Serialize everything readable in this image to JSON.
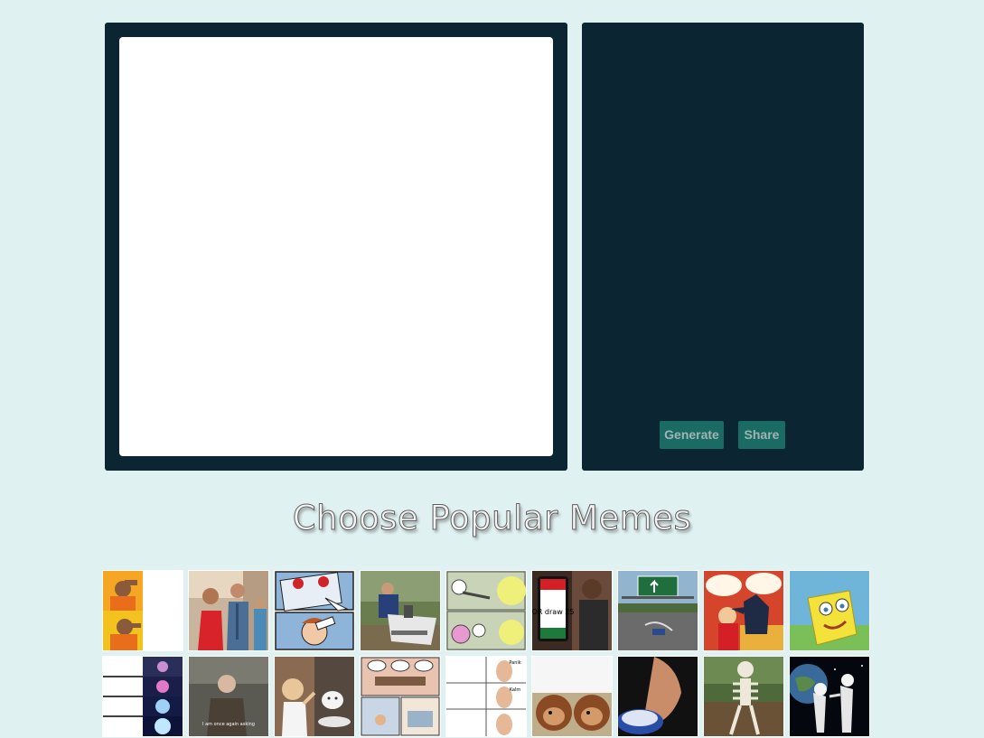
{
  "editor": {
    "generate_label": "Generate",
    "share_label": "Share"
  },
  "gallery": {
    "title": "Choose Popular Memes",
    "memes": [
      {
        "icon": "drake-meme-icon"
      },
      {
        "icon": "distracted-boyfriend-meme-icon"
      },
      {
        "icon": "two-buttons-meme-icon"
      },
      {
        "icon": "change-my-mind-meme-icon"
      },
      {
        "icon": "running-away-balloon-meme-icon"
      },
      {
        "icon": "uno-draw-25-meme-icon",
        "caption": "OR draw 25"
      },
      {
        "icon": "left-exit-12-off-ramp-meme-icon"
      },
      {
        "icon": "batman-slapping-robin-meme-icon"
      },
      {
        "icon": "mocking-spongebob-meme-icon"
      },
      {
        "icon": "expanding-brain-meme-icon"
      },
      {
        "icon": "bernie-asking-meme-icon",
        "caption": "I am once again asking"
      },
      {
        "icon": "woman-yelling-at-cat-meme-icon"
      },
      {
        "icon": "boardroom-meeting-meme-icon"
      },
      {
        "icon": "panik-kalm-meme-icon",
        "caption_top": "Panik",
        "caption_bottom": "Kalm"
      },
      {
        "icon": "monkey-puppet-meme-icon"
      },
      {
        "icon": "blank-nut-button-meme-icon"
      },
      {
        "icon": "waiting-skeleton-meme-icon"
      },
      {
        "icon": "always-has-been-meme-icon"
      }
    ]
  },
  "colors": {
    "page_bg": "#e0f1f1",
    "panel_bg": "#0b2533",
    "button_bg": "#1a6b64"
  }
}
